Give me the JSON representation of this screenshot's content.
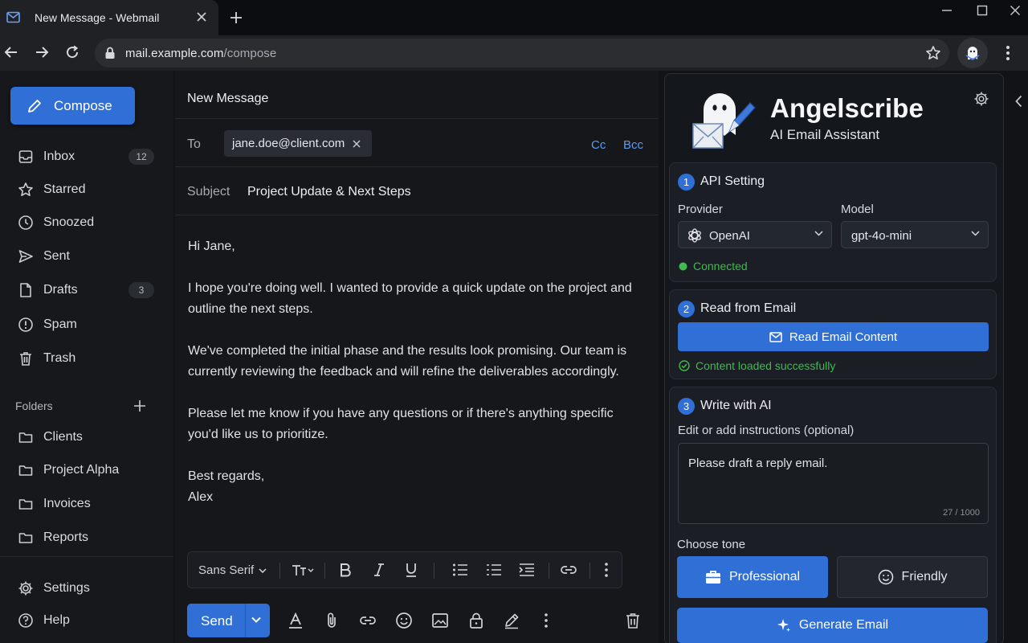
{
  "browser": {
    "tab_title": "New Message - Webmail",
    "url_host": "mail.example.com",
    "url_path": "/compose"
  },
  "sidebar": {
    "compose_label": "Compose",
    "nav": [
      {
        "label": "Inbox",
        "count": "12",
        "icon": "inbox-icon"
      },
      {
        "label": "Starred",
        "count": "",
        "icon": "star-icon"
      },
      {
        "label": "Snoozed",
        "count": "",
        "icon": "clock-icon"
      },
      {
        "label": "Sent",
        "count": "",
        "icon": "send-icon"
      },
      {
        "label": "Drafts",
        "count": "3",
        "icon": "draft-icon"
      },
      {
        "label": "Spam",
        "count": "",
        "icon": "spam-icon"
      },
      {
        "label": "Trash",
        "count": "",
        "icon": "trash-icon"
      }
    ],
    "folders_label": "Folders",
    "folders": [
      "Clients",
      "Project Alpha",
      "Invoices",
      "Reports"
    ],
    "settings_label": "Settings",
    "help_label": "Help"
  },
  "compose": {
    "title": "New Message",
    "to_label": "To",
    "to_recipient": "jane.doe@client.com",
    "cc_label": "Cc",
    "bcc_label": "Bcc",
    "subject_label": "Subject",
    "subject_value": "Project Update & Next Steps",
    "body": {
      "p1": "Hi Jane,",
      "p2": "I hope you're doing well. I wanted to provide a quick update on the project and outline the next steps.",
      "p3": "We've completed the initial phase and the results look promising. Our team is currently reviewing the feedback and will refine the deliverables accordingly.",
      "p4": "Please let me know if you have any questions or if there's anything specific you'd like us to prioritize.",
      "p5a": "Best regards,",
      "p5b": "Alex"
    },
    "font_label": "Sans Serif",
    "send_label": "Send"
  },
  "assistant": {
    "brand": "Angelscribe",
    "subtitle": "AI Email Assistant",
    "step1": {
      "num": "1",
      "title": "API Setting",
      "provider_label": "Provider",
      "provider_value": "OpenAI",
      "model_label": "Model",
      "model_value": "gpt-4o-mini",
      "status": "Connected"
    },
    "step2": {
      "num": "2",
      "title": "Read from Email",
      "button": "Read Email Content",
      "status": "Content loaded successfully"
    },
    "step3": {
      "num": "3",
      "title": "Write with AI",
      "instructions_label": "Edit or add instructions (optional)",
      "instructions_value": "Please draft a reply email.",
      "char_count": "27 / 1000",
      "tone_label": "Choose tone",
      "tone_professional": "Professional",
      "tone_friendly": "Friendly",
      "generate_label": "Generate Email"
    }
  },
  "colors": {
    "accent": "#2f6fd6",
    "link": "#5b9bf0",
    "success": "#3fb950"
  }
}
